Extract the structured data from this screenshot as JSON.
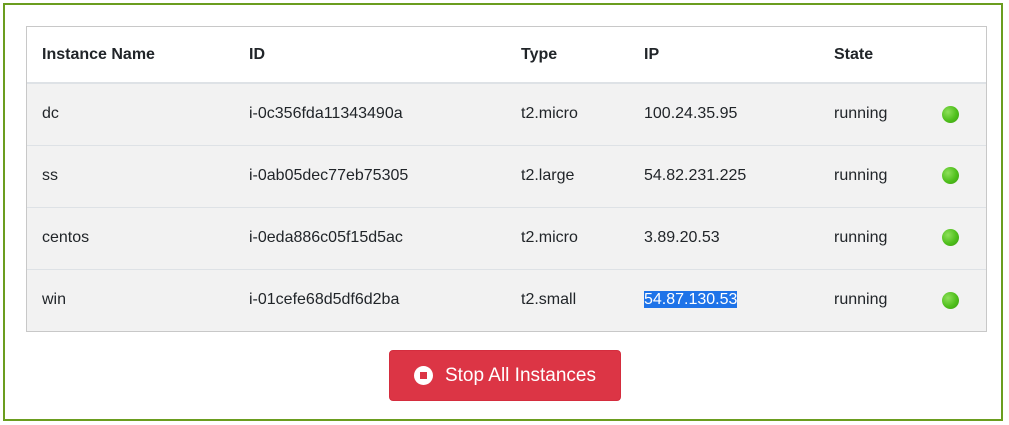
{
  "table": {
    "headers": {
      "name": "Instance Name",
      "id": "ID",
      "type": "Type",
      "ip": "IP",
      "state": "State"
    },
    "rows": [
      {
        "name": "dc",
        "id": "i-0c356fda11343490a",
        "type": "t2.micro",
        "ip": "100.24.35.95",
        "state": "running",
        "status_color": "#4fbf1c"
      },
      {
        "name": "ss",
        "id": "i-0ab05dec77eb75305",
        "type": "t2.large",
        "ip": "54.82.231.225",
        "state": "running",
        "status_color": "#4fbf1c"
      },
      {
        "name": "centos",
        "id": "i-0eda886c05f15d5ac",
        "type": "t2.micro",
        "ip": "3.89.20.53",
        "state": "running",
        "status_color": "#4fbf1c"
      },
      {
        "name": "win",
        "id": "i-01cefe68d5df6d2ba",
        "type": "t2.small",
        "ip": "54.87.130.53",
        "state": "running",
        "status_color": "#4fbf1c",
        "ip_selected": true
      }
    ]
  },
  "actions": {
    "stop_all_label": "Stop All Instances",
    "stop_icon": "stop-circle-icon",
    "button_color": "#dc3545"
  },
  "theme": {
    "frame_border": "#6b9d1f",
    "row_background": "#f2f2f2",
    "selection_color": "#1e73e8"
  }
}
